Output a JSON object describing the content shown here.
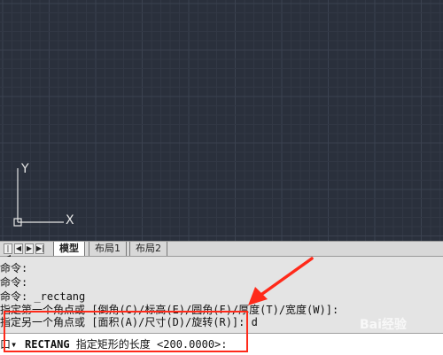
{
  "ucs": {
    "x_label": "X",
    "y_label": "Y"
  },
  "layout_tabs": {
    "nav_buttons": [
      "|◀",
      "◀",
      "▶",
      "▶|"
    ],
    "tabs": [
      {
        "label": "模型",
        "active": true
      },
      {
        "label": "布局1",
        "active": false
      },
      {
        "label": "布局2",
        "active": false
      }
    ]
  },
  "command_history": [
    "命令:",
    "命令:",
    "命令: _rectang",
    "指定第一个角点或 [倒角(C)/标高(E)/圆角(F)/厚度(T)/宽度(W)]:",
    "指定另一个角点或 [面积(A)/尺寸(D)/旋转(R)]: d"
  ],
  "command_input": {
    "prefix": "口▾",
    "command": "RECTANG",
    "prompt": " 指定矩形的长度 <200.0000>:"
  },
  "annotation": {
    "color": "#ff2a1a"
  },
  "watermark": {
    "main": "Bai经验",
    "sub": "jingyan.baidu.com"
  }
}
